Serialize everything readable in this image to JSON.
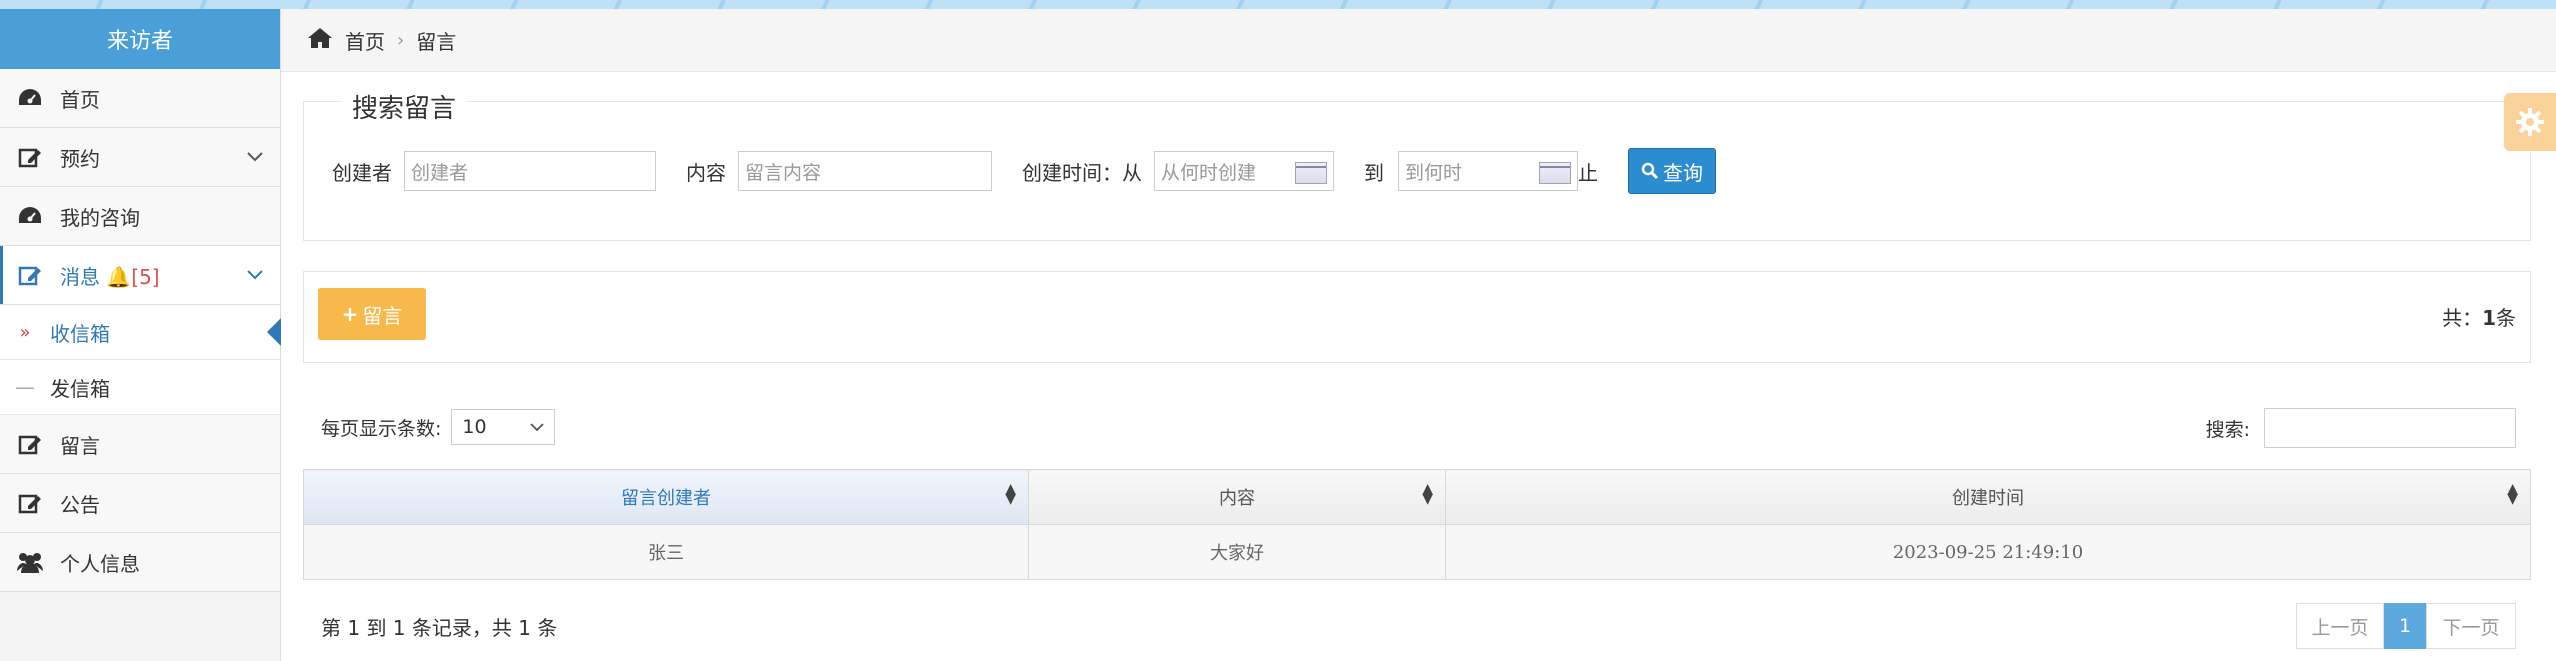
{
  "sidebar": {
    "header": "来访者",
    "items": [
      {
        "label": "首页",
        "icon": "dashboard-icon"
      },
      {
        "label": "预约",
        "icon": "edit-icon",
        "has_submenu": true
      },
      {
        "label": "我的咨询",
        "icon": "dashboard-icon"
      },
      {
        "label": "消息",
        "icon": "edit-icon",
        "badge": "[5]",
        "has_submenu": true,
        "open": true
      },
      {
        "label": "留言",
        "icon": "edit-icon"
      },
      {
        "label": "公告",
        "icon": "edit-icon"
      },
      {
        "label": "个人信息",
        "icon": "users-icon"
      }
    ],
    "subitems": [
      {
        "label": "收信箱",
        "marker": "»",
        "active": true
      },
      {
        "label": "发信箱",
        "marker": "—",
        "active": false
      }
    ]
  },
  "breadcrumb": {
    "home": "首页",
    "current": "留言"
  },
  "search": {
    "legend": "搜索留言",
    "creator_label": "创建者",
    "creator_placeholder": "创建者",
    "content_label": "内容",
    "content_placeholder": "留言内容",
    "time_label": "创建时间：从",
    "from_placeholder": "从何时创建",
    "to_label": "到",
    "to_placeholder": "到何时",
    "end_label": "止",
    "query_button": "查询"
  },
  "toolbar": {
    "add_button": "留言",
    "total_prefix": "共：",
    "total_count": "1",
    "total_suffix": "条"
  },
  "table_controls": {
    "length_label": "每页显示条数:",
    "length_value": "10",
    "search_label": "搜索:"
  },
  "table": {
    "columns": [
      "留言创建者",
      "内容",
      "创建时间"
    ],
    "rows": [
      [
        "张三",
        "大家好",
        "2023-09-25 21:49:10"
      ]
    ]
  },
  "footer": {
    "info": "第 1 到 1 条记录，共 1 条",
    "pager": {
      "prev": "上一页",
      "current": "1",
      "next": "下一页"
    }
  },
  "colors": {
    "accent": "#2f79b9",
    "header": "#4a9fd8",
    "add_button": "#f7b84c",
    "query_button": "#2b8ccf"
  }
}
